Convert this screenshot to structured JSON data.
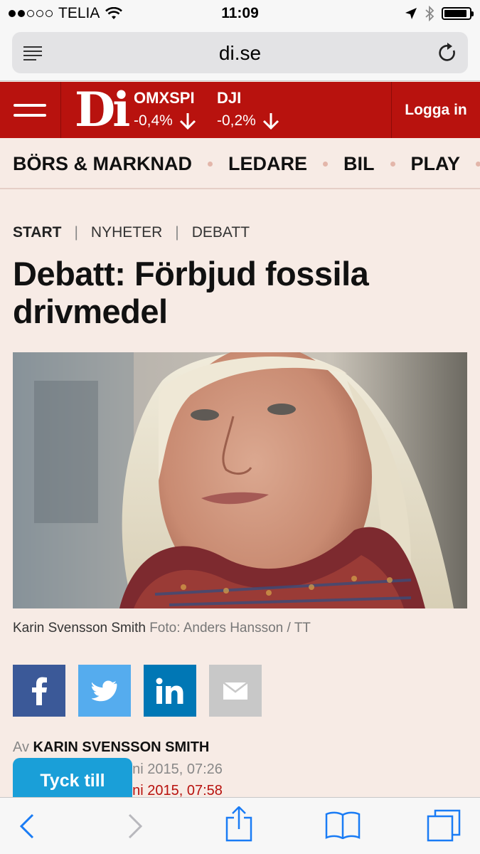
{
  "status_bar": {
    "carrier": "TELIA",
    "time": "11:09",
    "signal_bars_filled": 2,
    "signal_bars_total": 5,
    "battery_level": 0.9
  },
  "address_bar": {
    "url": "di.se",
    "icons": [
      "reader-icon",
      "reload-icon"
    ]
  },
  "header": {
    "logo": "Di",
    "tickers": [
      {
        "name": "OMXSPI",
        "change": "-0,4%",
        "direction": "down"
      },
      {
        "name": "DJI",
        "change": "-0,2%",
        "direction": "down"
      }
    ],
    "login_label": "Logga in",
    "colors": {
      "brand_red": "#b8120e",
      "page_bg": "#f7ebe5",
      "accent_blue": "#1a9fd8"
    }
  },
  "section_nav": {
    "items": [
      "BÖRS & MARKNAD",
      "LEDARE",
      "BIL",
      "PLAY"
    ]
  },
  "breadcrumb": {
    "items": [
      "START",
      "NYHETER",
      "DEBATT"
    ]
  },
  "article": {
    "headline": "Debatt: Förbjud fossila drivmedel",
    "photo_caption": "Karin Svensson Smith",
    "photo_credit": "Foto: Anders Hansson / TT",
    "byline_prefix": "Av",
    "author": "KARIN SVENSSON SMITH",
    "published": "uni 2015, 07:26",
    "updated": "uni 2015, 07:58"
  },
  "share_buttons": [
    {
      "network": "facebook",
      "color": "#3b5998"
    },
    {
      "network": "twitter",
      "color": "#55acee"
    },
    {
      "network": "linkedin",
      "color": "#0077b5"
    },
    {
      "network": "email",
      "color": "#c8c8c8"
    }
  ],
  "feedback_button": {
    "label": "Tyck till"
  },
  "toolbar": {
    "icons": [
      "back-icon",
      "forward-icon",
      "share-icon",
      "bookmarks-icon",
      "tabs-icon"
    ]
  }
}
